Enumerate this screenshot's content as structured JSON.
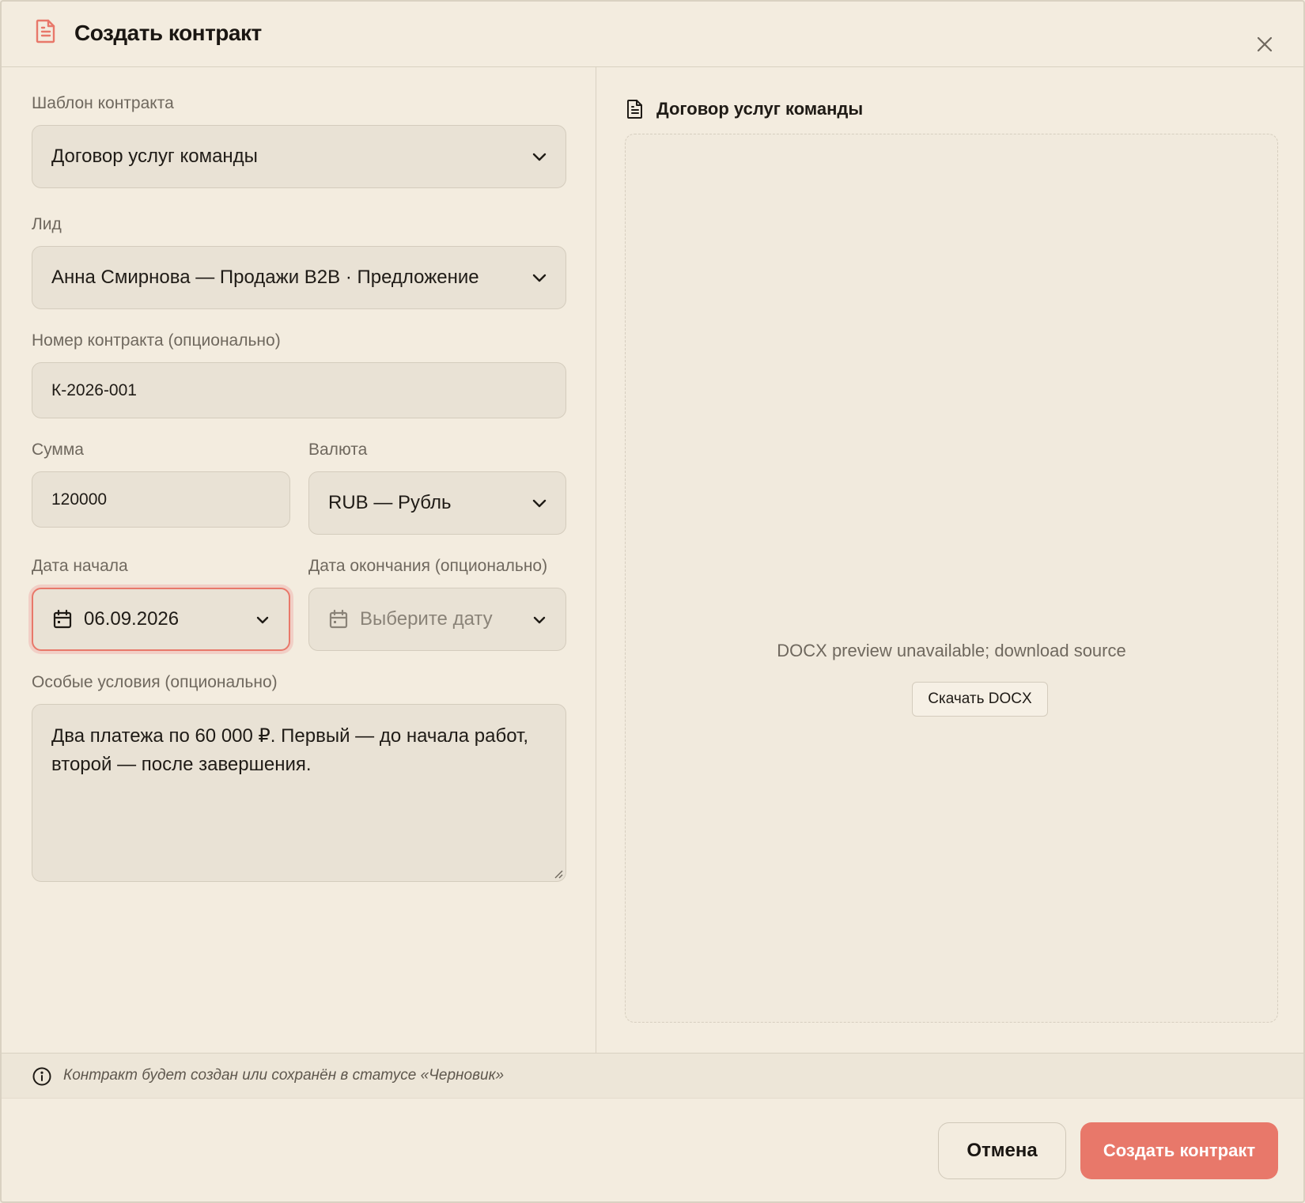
{
  "dialog": {
    "title": "Создать контракт",
    "header_icon": "document-icon",
    "close_icon": "close-icon"
  },
  "form": {
    "template": {
      "label": "Шаблон контракта",
      "value": "Договор услуг команды"
    },
    "lead": {
      "label": "Лид",
      "value": "Анна Смирнова — Продажи B2B · Предложение"
    },
    "contract_number": {
      "label": "Номер контракта (опционально)",
      "value": "К-2026-001"
    },
    "amount": {
      "label": "Сумма",
      "value": "120000"
    },
    "currency": {
      "label": "Валюта",
      "value": "RUB — Рубль"
    },
    "start_date": {
      "label": "Дата начала",
      "value": "06.09.2026"
    },
    "end_date": {
      "label": "Дата окончания (опционально)",
      "placeholder": "Выберите дату"
    },
    "special_terms": {
      "label": "Особые условия (опционально)",
      "value": "Два платежа по 60 000 ₽. Первый — до начала работ, второй — после завершения."
    }
  },
  "preview": {
    "title": "Договор услуг команды",
    "message": "DOCX preview unavailable; download source",
    "download_label": "Скачать DOCX"
  },
  "info": {
    "text": "Контракт будет создан или сохранён в статусе «Черновик»"
  },
  "footer": {
    "cancel_label": "Отмена",
    "submit_label": "Создать контракт"
  },
  "colors": {
    "accent": "#e8786a",
    "background": "#f3ecdf",
    "field": "#e9e2d5"
  }
}
